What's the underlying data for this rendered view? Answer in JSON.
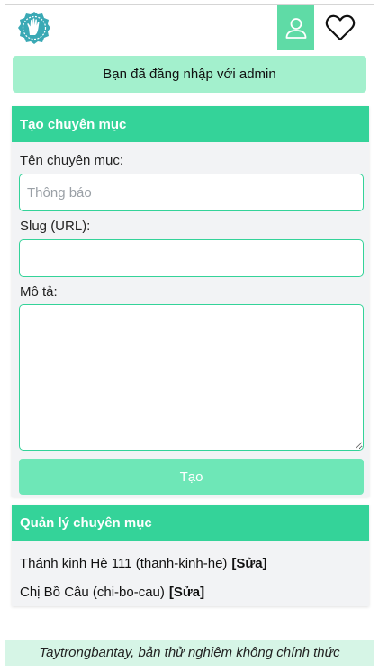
{
  "header": {
    "logo_icon": "hand-logo-icon",
    "account_icon": "user-icon",
    "favorites_icon": "heart-icon"
  },
  "notice": {
    "text": "Bạn đã đăng nhập với admin"
  },
  "create_section": {
    "title": "Tạo chuyên mục",
    "name_label": "Tên chuyên mục:",
    "name_placeholder": "Thông báo",
    "name_value": "",
    "slug_label": "Slug (URL):",
    "slug_value": "",
    "description_label": "Mô tả:",
    "description_value": "",
    "submit_label": "Tạo"
  },
  "manage_section": {
    "title": "Quản lý chuyên mục",
    "items": [
      {
        "text": "Thánh kinh Hè 111 (thanh-kinh-he)",
        "edit_label": "[Sửa]"
      },
      {
        "text": "Chị Bồ Câu (chi-bo-cau)",
        "edit_label": "[Sửa]"
      }
    ]
  },
  "footer": {
    "text": "Taytrongbantay, bản thử nghiệm không chính thức"
  },
  "colors": {
    "accent": "#34d399",
    "account_button": "#5fdba6",
    "notice_bg": "#a3f0cd",
    "submit_bg": "#6ee7b7",
    "footer_bg": "#d6f5e6",
    "card_bg": "#f2f3f5",
    "logo": "#3aa9b5"
  }
}
